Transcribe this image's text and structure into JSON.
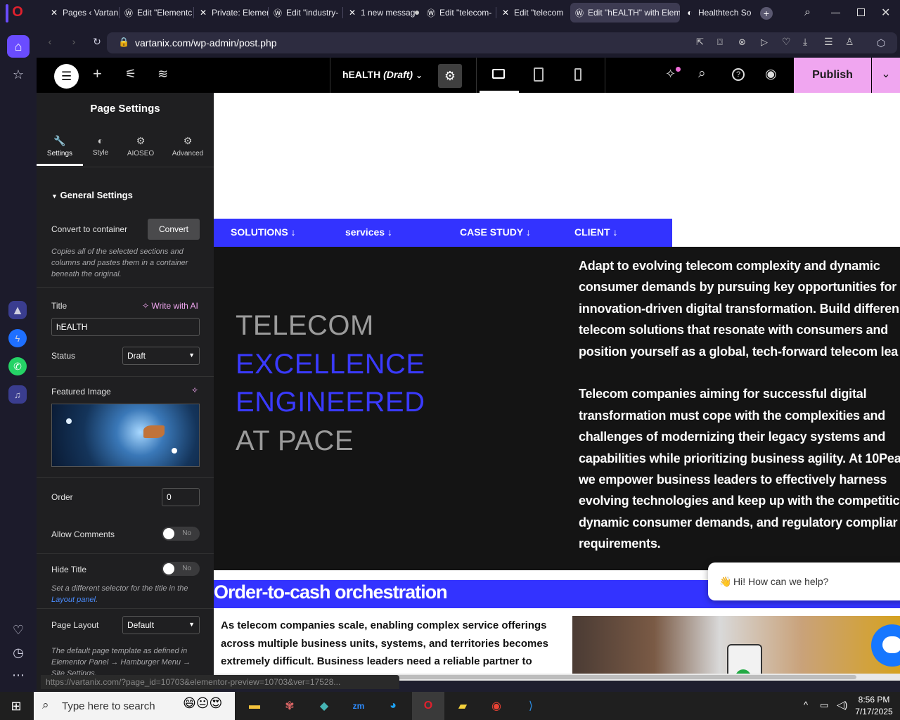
{
  "browser": {
    "tabs": [
      {
        "title": "Pages ‹ Vartan",
        "icon": "elementor-x-icon"
      },
      {
        "title": "Edit \"Elementc",
        "icon": "wordpress-icon"
      },
      {
        "title": "Private: Elemen",
        "icon": "elementor-x-icon"
      },
      {
        "title": "Edit \"industry-",
        "icon": "wordpress-icon"
      },
      {
        "title": "1 new messag",
        "icon": "elementor-x-icon"
      },
      {
        "title": "Edit \"telecom-",
        "icon": "wordpress-icon"
      },
      {
        "title": "Edit \"telecom",
        "icon": "elementor-x-icon"
      },
      {
        "title": "Edit \"hEALTH\" with Elem",
        "icon": "wordpress-icon"
      },
      {
        "title": "Healthtech So",
        "icon": "site-icon"
      }
    ],
    "url": "vartanix.com/wp-admin/post.php",
    "status_url": "https://vartanix.com/?page_id=10703&elementor-preview=10703&ver=17528..."
  },
  "elementor": {
    "doc_title": "hEALTH",
    "doc_status": "(Draft)",
    "publish_label": "Publish"
  },
  "panel": {
    "header": "Page Settings",
    "tabs": [
      "Settings",
      "Style",
      "AIOSEO",
      "Advanced"
    ],
    "section_title": "General Settings",
    "convert_label": "Convert to container",
    "convert_button": "Convert",
    "convert_hint": "Copies all of the selected sections and columns and pastes them in a container beneath the original.",
    "title_label": "Title",
    "write_ai": "Write with AI",
    "title_value": "hEALTH",
    "status_label": "Status",
    "status_value": "Draft",
    "featured_label": "Featured Image",
    "order_label": "Order",
    "order_value": "0",
    "allow_comments_label": "Allow Comments",
    "allow_comments_value": "No",
    "hide_title_label": "Hide Title",
    "hide_title_value": "No",
    "hide_title_hint_1": "Set a different selector for the title in the",
    "hide_title_hint_link": "Layout panel",
    "page_layout_label": "Page Layout",
    "page_layout_value": "Default",
    "page_layout_hint": "The default page template as defined in Elementor Panel → Hamburger Menu → Site Settings."
  },
  "canvas": {
    "nav": [
      "SOLUTIONS",
      "services",
      "CASE STUDY",
      "CLIENT"
    ],
    "hero_lines": [
      "TELECOM",
      "EXCELLENCE",
      "ENGINEERED",
      "AT PACE"
    ],
    "hero_colors": [
      "#9b9b9b",
      "#3a3aff",
      "#3a3aff",
      "#9b9b9b"
    ],
    "hero_para": "Adapt to evolving telecom complexity and dynamic\nconsumer demands by pursuing key opportunities for\ninnovation-driven digital transformation. Build differen\ntelecom solutions that resonate with consumers and\nposition yourself as a global, tech-forward telecom lea\n\nTelecom companies aiming for successful digital\ntransformation must cope with the complexities and\nchallenges of modernizing their legacy systems and\ncapabilities while prioritizing business agility. At 10Pea\nwe empower business leaders to effectively harness\nevolving technologies and keep up with the competitic\ndynamic consumer demands, and regulatory compliar\nrequirements.",
    "section_title": "Order-to-cash orchestration",
    "section_para": "As telecom companies scale, enabling complex service offerings\nacross multiple business units, systems, and territories becomes\nextremely difficult. Business leaders need a reliable partner to\nenhance customer delivery processes while overcoming challenges",
    "chat_text": "Hi! How can we help?"
  },
  "taskbar": {
    "search_placeholder": "Type here to search",
    "time": "8:56 PM",
    "date": "7/17/2025"
  },
  "colors": {
    "accent": "#3333ff",
    "publish": "#f0a6f0"
  }
}
